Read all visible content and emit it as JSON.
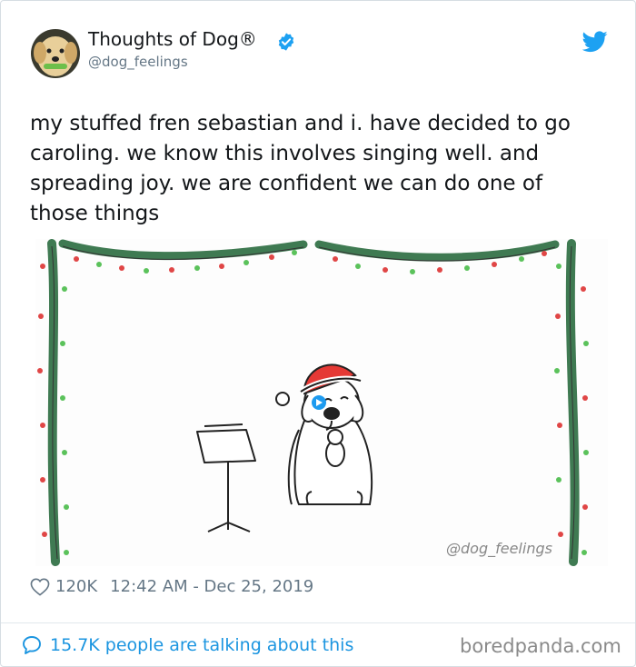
{
  "author": {
    "name": "Thoughts of Dog®",
    "handle": "@dog_feelings",
    "avatar": "dog-avatar"
  },
  "icons": {
    "verified": "verified-badge-icon",
    "platform": "twitter-bird-icon",
    "like": "heart-icon",
    "conversation": "speech-bubble-icon"
  },
  "tweet": {
    "text": "my stuffed fren sebastian and i. have decided to go\ncaroling. we know this involves singing well. and\nspreading joy. we are confident we can do one of\nthose things"
  },
  "media": {
    "signature": "@dog_feelings"
  },
  "meta": {
    "likes": "120K",
    "timestamp": "12:42 AM - Dec 25, 2019"
  },
  "footer": {
    "talking": "15.7K people are talking about this"
  },
  "watermark": "boredpanda.com",
  "colors": {
    "link_blue": "#1b95e0",
    "muted_gray": "#657786",
    "garland_green": "#3f7a52",
    "bulb_red": "#e04646",
    "bulb_green": "#5bc25b"
  }
}
